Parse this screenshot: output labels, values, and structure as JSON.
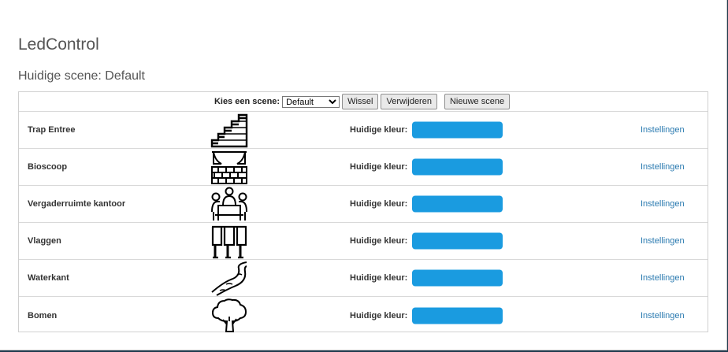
{
  "app": {
    "title": "LedControl",
    "current_scene_text": "Huidige scene: Default"
  },
  "toolbar": {
    "choose_scene_label": "Kies een scene:",
    "selected_scene": "Default",
    "switch_label": "Wissel",
    "delete_label": "Verwijderen",
    "new_scene_label": "Nieuwe scene"
  },
  "rooms": [
    {
      "name": "Trap Entree",
      "icon": "stairs-icon",
      "color_label": "Huidige kleur:",
      "color": "#1a9be0",
      "settings_label": "Instellingen"
    },
    {
      "name": "Bioscoop",
      "icon": "cinema-stage-icon",
      "color_label": "Huidige kleur:",
      "color": "#1a9be0",
      "settings_label": "Instellingen"
    },
    {
      "name": "Vergaderruimte kantoor",
      "icon": "meeting-room-icon",
      "color_label": "Huidige kleur:",
      "color": "#1a9be0",
      "settings_label": "Instellingen"
    },
    {
      "name": "Vlaggen",
      "icon": "flags-icon",
      "color_label": "Huidige kleur:",
      "color": "#1a9be0",
      "settings_label": "Instellingen"
    },
    {
      "name": "Waterkant",
      "icon": "river-icon",
      "color_label": "Huidige kleur:",
      "color": "#1a9be0",
      "settings_label": "Instellingen"
    },
    {
      "name": "Bomen",
      "icon": "tree-icon",
      "color_label": "Huidige kleur:",
      "color": "#1a9be0",
      "settings_label": "Instellingen"
    }
  ]
}
